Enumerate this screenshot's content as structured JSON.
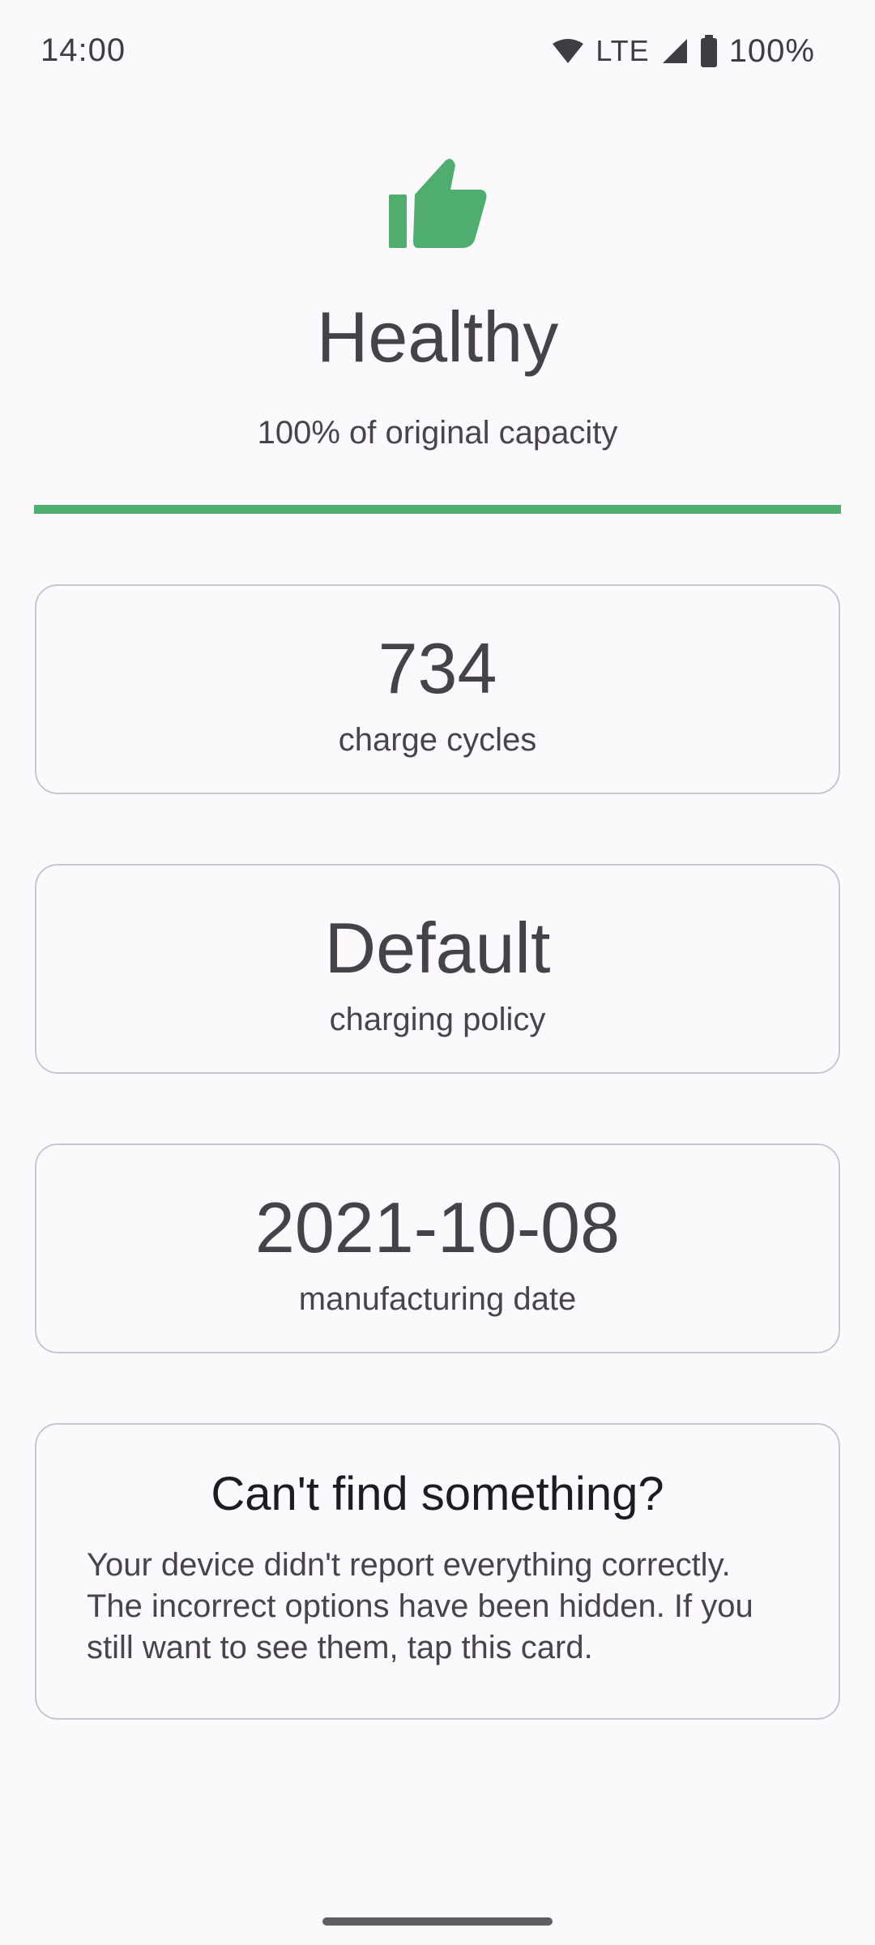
{
  "status_bar": {
    "time": "14:00",
    "network": "LTE",
    "battery_percent": "100%",
    "icons": [
      "wifi-icon",
      "cell-signal-icon",
      "battery-icon"
    ]
  },
  "header": {
    "icon": "thumbs-up-icon",
    "title": "Healthy",
    "subtitle": "100% of original capacity",
    "capacity_fraction": 1.0
  },
  "cards": [
    {
      "value": "734",
      "label": "charge cycles"
    },
    {
      "value": "Default",
      "label": "charging policy"
    },
    {
      "value": "2021-10-08",
      "label": "manufacturing date"
    }
  ],
  "info_card": {
    "title": "Can't find something?",
    "body": "Your device didn't report everything correctly. The incorrect options have been hidden. If you still want to see them, tap this card."
  },
  "colors": {
    "accent_green": "#4FAE6F",
    "background": "#FCF9FC",
    "text": "#45424A",
    "card_border": "#C9C6CC"
  }
}
